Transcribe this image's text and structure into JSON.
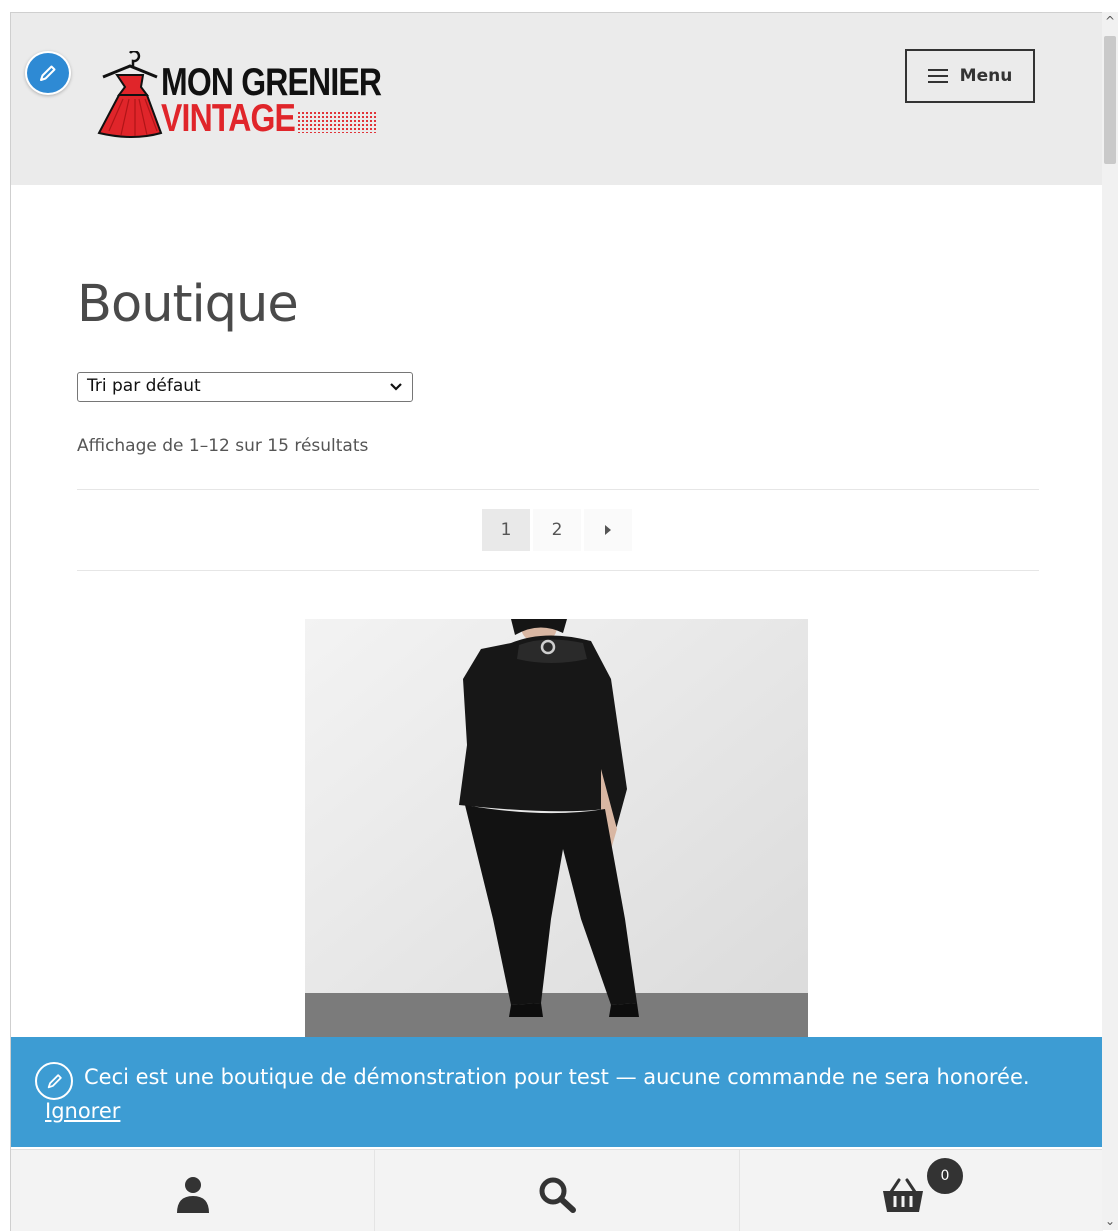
{
  "header": {
    "logo_line1": "MON GRENIER",
    "logo_line2": "VINTAGE",
    "menu_label": "Menu"
  },
  "main": {
    "title": "Boutique",
    "sort": {
      "selected": "Tri par défaut"
    },
    "result_count": "Affichage de 1–12 sur 15 résultats",
    "pagination": {
      "pages": [
        "1",
        "2"
      ],
      "current": "1"
    }
  },
  "notice": {
    "text": "Ceci est une boutique de démonstration pour test — aucune commande ne sera honorée.",
    "dismiss": "Ignorer"
  },
  "handheld": {
    "cart_count": "0"
  },
  "colors": {
    "accent": "#3d9cd3",
    "brand_red": "#e0252a",
    "header_bg": "#ebebeb"
  }
}
